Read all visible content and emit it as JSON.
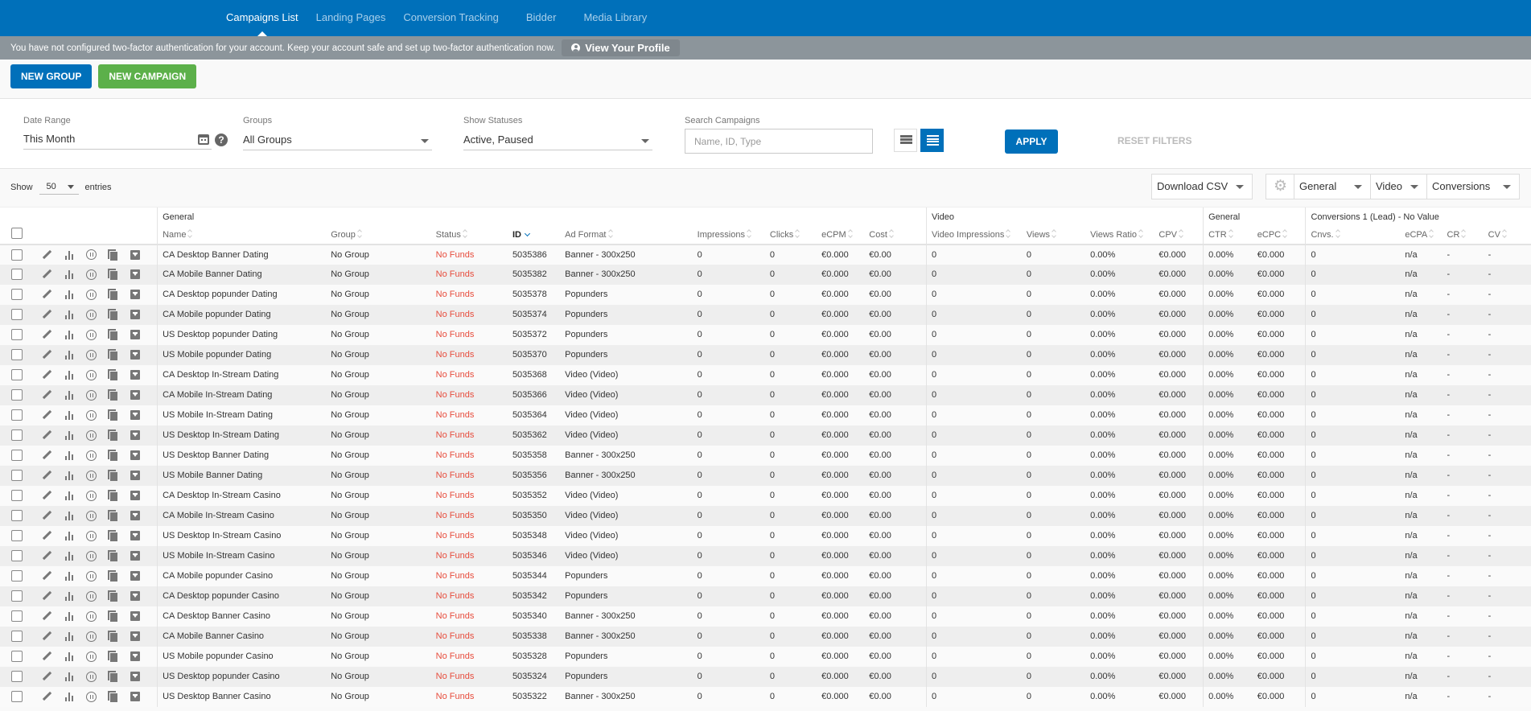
{
  "nav": {
    "tabs": [
      {
        "label": "Campaigns List",
        "active": true
      },
      {
        "label": "Landing Pages",
        "active": false
      },
      {
        "label": "Conversion Tracking",
        "active": false
      },
      {
        "label": "Bidder",
        "active": false
      },
      {
        "label": "Media Library",
        "active": false
      }
    ]
  },
  "banner": {
    "message": "You have not configured two-factor authentication for your account. Keep your account safe and set up two-factor authentication now.",
    "button_label": "View Your Profile",
    "button_icon": "user-circle-icon"
  },
  "actions": {
    "new_group": "NEW GROUP",
    "new_campaign": "NEW CAMPAIGN"
  },
  "filters": {
    "date_range": {
      "label": "Date Range",
      "value": "This Month"
    },
    "groups": {
      "label": "Groups",
      "value": "All Groups"
    },
    "statuses": {
      "label": "Show Statuses",
      "value": "Active, Paused"
    },
    "search": {
      "label": "Search Campaigns",
      "placeholder": "Name, ID, Type",
      "value": ""
    },
    "apply": "APPLY",
    "reset": "RESET FILTERS"
  },
  "toolbar": {
    "show": "Show",
    "entries_value": "50",
    "entries": "entries",
    "download": "Download CSV",
    "toggles": [
      "General",
      "Video",
      "Conversions"
    ]
  },
  "colors": {
    "brand": "#0070ba",
    "green": "#5cb04a",
    "status_no_funds": "#e74c3c",
    "banner": "#8c959b"
  },
  "table": {
    "groups": {
      "general": "General",
      "video": "Video",
      "general2": "General",
      "conversions": "Conversions 1 (Lead) - No Value"
    },
    "columns": {
      "name": "Name",
      "group": "Group",
      "status": "Status",
      "id": "ID",
      "ad_format": "Ad Format",
      "impressions": "Impressions",
      "clicks": "Clicks",
      "ecpm": "eCPM",
      "cost": "Cost",
      "video_impressions": "Video Impressions",
      "views": "Views",
      "views_ratio": "Views Ratio",
      "cpv": "CPV",
      "ctr": "CTR",
      "ecpc": "eCPC",
      "cnvs": "Cnvs.",
      "ecpa": "eCPA",
      "cr": "CR",
      "cv": "CV"
    },
    "rows": [
      {
        "name": "CA Desktop Banner Dating",
        "group": "No Group",
        "status": "No Funds",
        "id": "5035386",
        "ad_format": "Banner - 300x250",
        "impressions": "0",
        "clicks": "0",
        "ecpm": "€0.000",
        "cost": "€0.00",
        "video_impressions": "0",
        "views": "0",
        "views_ratio": "0.00%",
        "cpv": "€0.000",
        "ctr": "0.00%",
        "ecpc": "€0.000",
        "cnvs": "0",
        "ecpa": "n/a",
        "cr": "-",
        "cv": "-"
      },
      {
        "name": "CA Mobile Banner Dating",
        "group": "No Group",
        "status": "No Funds",
        "id": "5035382",
        "ad_format": "Banner - 300x250",
        "impressions": "0",
        "clicks": "0",
        "ecpm": "€0.000",
        "cost": "€0.00",
        "video_impressions": "0",
        "views": "0",
        "views_ratio": "0.00%",
        "cpv": "€0.000",
        "ctr": "0.00%",
        "ecpc": "€0.000",
        "cnvs": "0",
        "ecpa": "n/a",
        "cr": "-",
        "cv": "-"
      },
      {
        "name": "CA Desktop popunder Dating",
        "group": "No Group",
        "status": "No Funds",
        "id": "5035378",
        "ad_format": "Popunders",
        "impressions": "0",
        "clicks": "0",
        "ecpm": "€0.000",
        "cost": "€0.00",
        "video_impressions": "0",
        "views": "0",
        "views_ratio": "0.00%",
        "cpv": "€0.000",
        "ctr": "0.00%",
        "ecpc": "€0.000",
        "cnvs": "0",
        "ecpa": "n/a",
        "cr": "-",
        "cv": "-"
      },
      {
        "name": "CA Mobile popunder Dating",
        "group": "No Group",
        "status": "No Funds",
        "id": "5035374",
        "ad_format": "Popunders",
        "impressions": "0",
        "clicks": "0",
        "ecpm": "€0.000",
        "cost": "€0.00",
        "video_impressions": "0",
        "views": "0",
        "views_ratio": "0.00%",
        "cpv": "€0.000",
        "ctr": "0.00%",
        "ecpc": "€0.000",
        "cnvs": "0",
        "ecpa": "n/a",
        "cr": "-",
        "cv": "-"
      },
      {
        "name": "US Desktop popunder Dating",
        "group": "No Group",
        "status": "No Funds",
        "id": "5035372",
        "ad_format": "Popunders",
        "impressions": "0",
        "clicks": "0",
        "ecpm": "€0.000",
        "cost": "€0.00",
        "video_impressions": "0",
        "views": "0",
        "views_ratio": "0.00%",
        "cpv": "€0.000",
        "ctr": "0.00%",
        "ecpc": "€0.000",
        "cnvs": "0",
        "ecpa": "n/a",
        "cr": "-",
        "cv": "-"
      },
      {
        "name": "US Mobile popunder Dating",
        "group": "No Group",
        "status": "No Funds",
        "id": "5035370",
        "ad_format": "Popunders",
        "impressions": "0",
        "clicks": "0",
        "ecpm": "€0.000",
        "cost": "€0.00",
        "video_impressions": "0",
        "views": "0",
        "views_ratio": "0.00%",
        "cpv": "€0.000",
        "ctr": "0.00%",
        "ecpc": "€0.000",
        "cnvs": "0",
        "ecpa": "n/a",
        "cr": "-",
        "cv": "-"
      },
      {
        "name": "CA Desktop In-Stream Dating",
        "group": "No Group",
        "status": "No Funds",
        "id": "5035368",
        "ad_format": "Video (Video)",
        "impressions": "0",
        "clicks": "0",
        "ecpm": "€0.000",
        "cost": "€0.00",
        "video_impressions": "0",
        "views": "0",
        "views_ratio": "0.00%",
        "cpv": "€0.000",
        "ctr": "0.00%",
        "ecpc": "€0.000",
        "cnvs": "0",
        "ecpa": "n/a",
        "cr": "-",
        "cv": "-"
      },
      {
        "name": "CA Mobile In-Stream Dating",
        "group": "No Group",
        "status": "No Funds",
        "id": "5035366",
        "ad_format": "Video (Video)",
        "impressions": "0",
        "clicks": "0",
        "ecpm": "€0.000",
        "cost": "€0.00",
        "video_impressions": "0",
        "views": "0",
        "views_ratio": "0.00%",
        "cpv": "€0.000",
        "ctr": "0.00%",
        "ecpc": "€0.000",
        "cnvs": "0",
        "ecpa": "n/a",
        "cr": "-",
        "cv": "-"
      },
      {
        "name": "US Mobile In-Stream Dating",
        "group": "No Group",
        "status": "No Funds",
        "id": "5035364",
        "ad_format": "Video (Video)",
        "impressions": "0",
        "clicks": "0",
        "ecpm": "€0.000",
        "cost": "€0.00",
        "video_impressions": "0",
        "views": "0",
        "views_ratio": "0.00%",
        "cpv": "€0.000",
        "ctr": "0.00%",
        "ecpc": "€0.000",
        "cnvs": "0",
        "ecpa": "n/a",
        "cr": "-",
        "cv": "-"
      },
      {
        "name": "US Desktop In-Stream Dating",
        "group": "No Group",
        "status": "No Funds",
        "id": "5035362",
        "ad_format": "Video (Video)",
        "impressions": "0",
        "clicks": "0",
        "ecpm": "€0.000",
        "cost": "€0.00",
        "video_impressions": "0",
        "views": "0",
        "views_ratio": "0.00%",
        "cpv": "€0.000",
        "ctr": "0.00%",
        "ecpc": "€0.000",
        "cnvs": "0",
        "ecpa": "n/a",
        "cr": "-",
        "cv": "-"
      },
      {
        "name": "US Desktop Banner Dating",
        "group": "No Group",
        "status": "No Funds",
        "id": "5035358",
        "ad_format": "Banner - 300x250",
        "impressions": "0",
        "clicks": "0",
        "ecpm": "€0.000",
        "cost": "€0.00",
        "video_impressions": "0",
        "views": "0",
        "views_ratio": "0.00%",
        "cpv": "€0.000",
        "ctr": "0.00%",
        "ecpc": "€0.000",
        "cnvs": "0",
        "ecpa": "n/a",
        "cr": "-",
        "cv": "-"
      },
      {
        "name": "US Mobile Banner Dating",
        "group": "No Group",
        "status": "No Funds",
        "id": "5035356",
        "ad_format": "Banner - 300x250",
        "impressions": "0",
        "clicks": "0",
        "ecpm": "€0.000",
        "cost": "€0.00",
        "video_impressions": "0",
        "views": "0",
        "views_ratio": "0.00%",
        "cpv": "€0.000",
        "ctr": "0.00%",
        "ecpc": "€0.000",
        "cnvs": "0",
        "ecpa": "n/a",
        "cr": "-",
        "cv": "-"
      },
      {
        "name": "CA Desktop In-Stream Casino",
        "group": "No Group",
        "status": "No Funds",
        "id": "5035352",
        "ad_format": "Video (Video)",
        "impressions": "0",
        "clicks": "0",
        "ecpm": "€0.000",
        "cost": "€0.00",
        "video_impressions": "0",
        "views": "0",
        "views_ratio": "0.00%",
        "cpv": "€0.000",
        "ctr": "0.00%",
        "ecpc": "€0.000",
        "cnvs": "0",
        "ecpa": "n/a",
        "cr": "-",
        "cv": "-"
      },
      {
        "name": "CA Mobile In-Stream Casino",
        "group": "No Group",
        "status": "No Funds",
        "id": "5035350",
        "ad_format": "Video (Video)",
        "impressions": "0",
        "clicks": "0",
        "ecpm": "€0.000",
        "cost": "€0.00",
        "video_impressions": "0",
        "views": "0",
        "views_ratio": "0.00%",
        "cpv": "€0.000",
        "ctr": "0.00%",
        "ecpc": "€0.000",
        "cnvs": "0",
        "ecpa": "n/a",
        "cr": "-",
        "cv": "-"
      },
      {
        "name": "US Desktop In-Stream Casino",
        "group": "No Group",
        "status": "No Funds",
        "id": "5035348",
        "ad_format": "Video (Video)",
        "impressions": "0",
        "clicks": "0",
        "ecpm": "€0.000",
        "cost": "€0.00",
        "video_impressions": "0",
        "views": "0",
        "views_ratio": "0.00%",
        "cpv": "€0.000",
        "ctr": "0.00%",
        "ecpc": "€0.000",
        "cnvs": "0",
        "ecpa": "n/a",
        "cr": "-",
        "cv": "-"
      },
      {
        "name": "US Mobile In-Stream Casino",
        "group": "No Group",
        "status": "No Funds",
        "id": "5035346",
        "ad_format": "Video (Video)",
        "impressions": "0",
        "clicks": "0",
        "ecpm": "€0.000",
        "cost": "€0.00",
        "video_impressions": "0",
        "views": "0",
        "views_ratio": "0.00%",
        "cpv": "€0.000",
        "ctr": "0.00%",
        "ecpc": "€0.000",
        "cnvs": "0",
        "ecpa": "n/a",
        "cr": "-",
        "cv": "-"
      },
      {
        "name": "CA Mobile popunder Casino",
        "group": "No Group",
        "status": "No Funds",
        "id": "5035344",
        "ad_format": "Popunders",
        "impressions": "0",
        "clicks": "0",
        "ecpm": "€0.000",
        "cost": "€0.00",
        "video_impressions": "0",
        "views": "0",
        "views_ratio": "0.00%",
        "cpv": "€0.000",
        "ctr": "0.00%",
        "ecpc": "€0.000",
        "cnvs": "0",
        "ecpa": "n/a",
        "cr": "-",
        "cv": "-"
      },
      {
        "name": "CA Desktop popunder Casino",
        "group": "No Group",
        "status": "No Funds",
        "id": "5035342",
        "ad_format": "Popunders",
        "impressions": "0",
        "clicks": "0",
        "ecpm": "€0.000",
        "cost": "€0.00",
        "video_impressions": "0",
        "views": "0",
        "views_ratio": "0.00%",
        "cpv": "€0.000",
        "ctr": "0.00%",
        "ecpc": "€0.000",
        "cnvs": "0",
        "ecpa": "n/a",
        "cr": "-",
        "cv": "-"
      },
      {
        "name": "CA Desktop Banner Casino",
        "group": "No Group",
        "status": "No Funds",
        "id": "5035340",
        "ad_format": "Banner - 300x250",
        "impressions": "0",
        "clicks": "0",
        "ecpm": "€0.000",
        "cost": "€0.00",
        "video_impressions": "0",
        "views": "0",
        "views_ratio": "0.00%",
        "cpv": "€0.000",
        "ctr": "0.00%",
        "ecpc": "€0.000",
        "cnvs": "0",
        "ecpa": "n/a",
        "cr": "-",
        "cv": "-"
      },
      {
        "name": "CA Mobile Banner Casino",
        "group": "No Group",
        "status": "No Funds",
        "id": "5035338",
        "ad_format": "Banner - 300x250",
        "impressions": "0",
        "clicks": "0",
        "ecpm": "€0.000",
        "cost": "€0.00",
        "video_impressions": "0",
        "views": "0",
        "views_ratio": "0.00%",
        "cpv": "€0.000",
        "ctr": "0.00%",
        "ecpc": "€0.000",
        "cnvs": "0",
        "ecpa": "n/a",
        "cr": "-",
        "cv": "-"
      },
      {
        "name": "US Mobile popunder Casino",
        "group": "No Group",
        "status": "No Funds",
        "id": "5035328",
        "ad_format": "Popunders",
        "impressions": "0",
        "clicks": "0",
        "ecpm": "€0.000",
        "cost": "€0.00",
        "video_impressions": "0",
        "views": "0",
        "views_ratio": "0.00%",
        "cpv": "€0.000",
        "ctr": "0.00%",
        "ecpc": "€0.000",
        "cnvs": "0",
        "ecpa": "n/a",
        "cr": "-",
        "cv": "-"
      },
      {
        "name": "US Desktop popunder Casino",
        "group": "No Group",
        "status": "No Funds",
        "id": "5035324",
        "ad_format": "Popunders",
        "impressions": "0",
        "clicks": "0",
        "ecpm": "€0.000",
        "cost": "€0.00",
        "video_impressions": "0",
        "views": "0",
        "views_ratio": "0.00%",
        "cpv": "€0.000",
        "ctr": "0.00%",
        "ecpc": "€0.000",
        "cnvs": "0",
        "ecpa": "n/a",
        "cr": "-",
        "cv": "-"
      },
      {
        "name": "US Desktop Banner Casino",
        "group": "No Group",
        "status": "No Funds",
        "id": "5035322",
        "ad_format": "Banner - 300x250",
        "impressions": "0",
        "clicks": "0",
        "ecpm": "€0.000",
        "cost": "€0.00",
        "video_impressions": "0",
        "views": "0",
        "views_ratio": "0.00%",
        "cpv": "€0.000",
        "ctr": "0.00%",
        "ecpc": "€0.000",
        "cnvs": "0",
        "ecpa": "n/a",
        "cr": "-",
        "cv": "-"
      }
    ]
  }
}
